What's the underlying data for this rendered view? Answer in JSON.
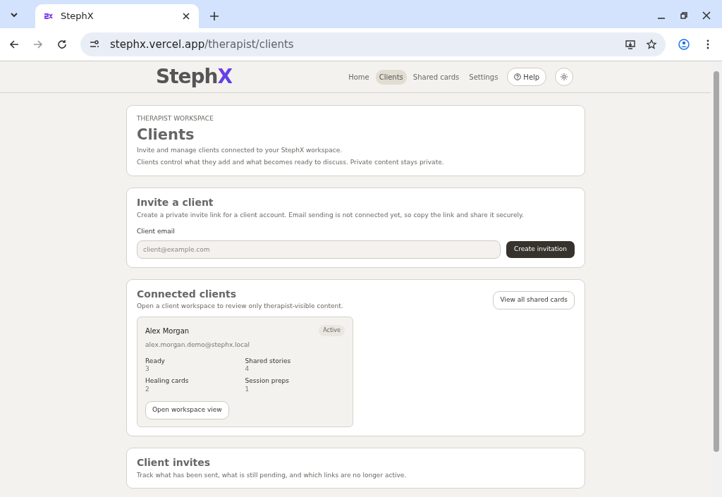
{
  "browser": {
    "tab_title": "StephX",
    "url_host": "stephx.vercel.app",
    "url_path": "/therapist/clients"
  },
  "header": {
    "logo": {
      "text": "Steph",
      "accent": "X"
    },
    "nav": [
      {
        "label": "Home",
        "selected": false
      },
      {
        "label": "Clients",
        "selected": true
      },
      {
        "label": "Shared cards",
        "selected": false
      },
      {
        "label": "Settings",
        "selected": false
      }
    ],
    "help_button": "Help"
  },
  "intro": {
    "eyebrow": "THERAPIST WORKSPACE",
    "title": "Clients",
    "lines": [
      "Invite and manage clients connected to your StephX workspace.",
      "Clients control what they add and what becomes ready to discuss. Private content stays private."
    ]
  },
  "invite": {
    "title": "Invite a client",
    "description": "Create a private invite link for a client account. Email sending is not connected yet, so copy the link and share it securely.",
    "field_label": "Client email",
    "placeholder": "client@example.com",
    "button": "Create invitation"
  },
  "connected": {
    "title": "Connected clients",
    "description": "Open a client workspace to review only therapist-visible content.",
    "button": "View all shared cards",
    "clients": [
      {
        "name": "Alex Morgan",
        "status": "Active",
        "email": "alex.morgan.demo@stephx.local",
        "stats": [
          {
            "label": "Ready",
            "value": "3"
          },
          {
            "label": "Shared stories",
            "value": "4"
          },
          {
            "label": "Healing cards",
            "value": "2"
          },
          {
            "label": "Session preps",
            "value": "1"
          }
        ],
        "button": "Open workspace view"
      }
    ]
  },
  "invites": {
    "title": "Client invites",
    "description": "Track what has been sent, what is still pending, and which links are no longer active."
  }
}
